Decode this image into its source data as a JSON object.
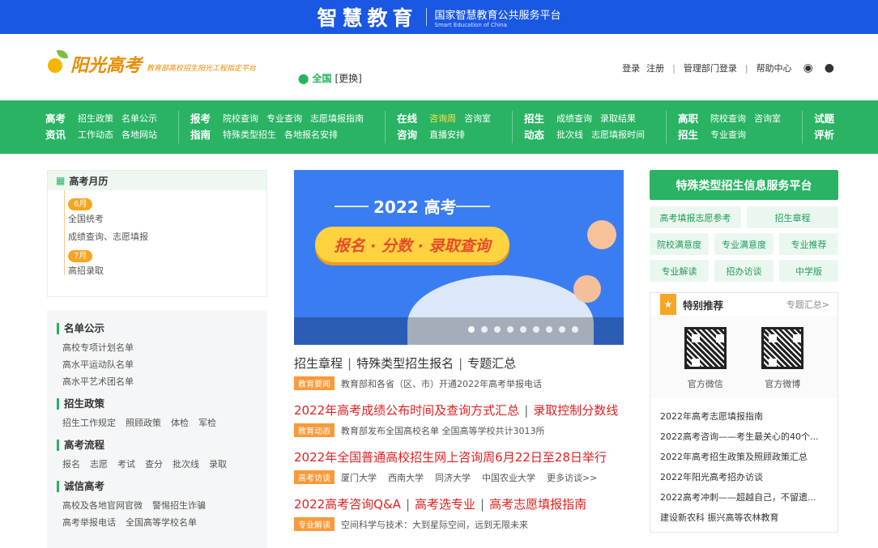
{
  "topbar": {
    "brand": "智慧教育",
    "platform_cn": "国家智慧教育公共服务平台",
    "platform_en": "Smart Education of China"
  },
  "header": {
    "logo_name": "阳光高考",
    "logo_tagline": "教育部高校招生阳光工程指定平台",
    "region": "全国",
    "region_change": "[更换]",
    "links": [
      "登录",
      "注册",
      "管理部门登录",
      "帮助中心"
    ],
    "icons": [
      "weibo-icon",
      "wechat-icon"
    ]
  },
  "nav": [
    {
      "head": "高考资讯",
      "rows": [
        [
          "招生政策",
          "名单公示"
        ],
        [
          "工作动态",
          "各地网站"
        ]
      ]
    },
    {
      "head": "报考指南",
      "rows": [
        [
          "院校查询",
          "专业查询",
          "志愿填报指南"
        ],
        [
          "特殊类型招生",
          "各地报名安排"
        ]
      ]
    },
    {
      "head": "在线咨询",
      "rows": [
        [
          "咨询周",
          "咨询室"
        ],
        [
          "直播安排"
        ]
      ]
    },
    {
      "head": "招生动态",
      "rows": [
        [
          "成绩查询",
          "录取结果"
        ],
        [
          "批次线",
          "志愿填报时间"
        ]
      ]
    },
    {
      "head": "高职招生",
      "rows": [
        [
          "院校查询",
          "咨询室"
        ],
        [
          "专业查询"
        ]
      ]
    },
    {
      "head": "试题评析",
      "rows": []
    }
  ],
  "calendar": {
    "title": "高考月历",
    "groups": [
      {
        "month": "6月",
        "items": [
          "全国统考",
          "成绩查询、志愿填报"
        ]
      },
      {
        "month": "7月",
        "items": [
          "高招录取"
        ]
      }
    ]
  },
  "side": [
    {
      "title": "名单公示",
      "lines": [
        [
          "高校专项计划名单"
        ],
        [
          "高水平运动队名单"
        ],
        [
          "高水平艺术团名单"
        ]
      ]
    },
    {
      "title": "招生政策",
      "lines": [
        [
          "招生工作规定",
          "照顾政策",
          "体检",
          "军检"
        ]
      ]
    },
    {
      "title": "高考流程",
      "lines": [
        [
          "报名",
          "志愿",
          "考试",
          "查分",
          "批次线",
          "录取"
        ]
      ]
    },
    {
      "title": "诚信高考",
      "lines": [
        [
          "高校及各地官网官微",
          "警惕招生诈骗"
        ],
        [
          "高考举报电话",
          "全国高等学校名单"
        ]
      ]
    }
  ],
  "banner": {
    "heading": "2022 高考",
    "pill": "报名 · 分数 · 录取查询"
  },
  "news": [
    {
      "title_parts": [
        "招生章程",
        "特殊类型招生报名",
        "专题汇总"
      ],
      "red": false,
      "tag": "教育要闻",
      "subs": [
        "教育部和各省（区、市）开通2022年高考举报电话"
      ]
    },
    {
      "title_parts": [
        "2022年高考成绩公布时间及查询方式汇总",
        "录取控制分数线"
      ],
      "red": true,
      "tag": "教育动态",
      "subs": [
        "教育部发布全国高校名单 全国高等学校共计3013所"
      ]
    },
    {
      "title_parts": [
        "2022年全国普通高校招生网上咨询周6月22日至28日举行"
      ],
      "red": true,
      "tag": "高考访谈",
      "subs": [
        "厦门大学",
        "西南大学",
        "同济大学",
        "中国农业大学",
        "更多访谈>>"
      ]
    },
    {
      "title_parts": [
        "2022高考咨询Q&A",
        "高考选专业",
        "高考志愿填报指南"
      ],
      "red": true,
      "tag": "专业解读",
      "subs": [
        "空间科学与技术：大到星际空间，远到无限未来"
      ]
    }
  ],
  "right": {
    "platform_btn": "特殊类型招生信息服务平台",
    "grid_rows": [
      [
        "高考填报志愿参考",
        "招生章程"
      ],
      [
        "院校满意度",
        "专业满意度",
        "专业推荐"
      ],
      [
        "专业解读",
        "招办访谈",
        "中学版"
      ]
    ],
    "rec_title": "特别推荐",
    "rec_more": "专题汇总>",
    "qr": [
      "官方微信",
      "官方微博"
    ],
    "list": [
      "2022年高考志愿填报指南",
      "2022高考咨询——考生最关心的40个...",
      "2022年高考招生政策及照顾政策汇总",
      "2022年阳光高考招办访谈",
      "2022高考冲刺——超越自己，不留遗...",
      "建设新农科 振兴高等农林教育"
    ]
  },
  "colors": {
    "blue": "#1a57e3",
    "green": "#29b363",
    "orange": "#f5a623",
    "red": "#e02020"
  }
}
